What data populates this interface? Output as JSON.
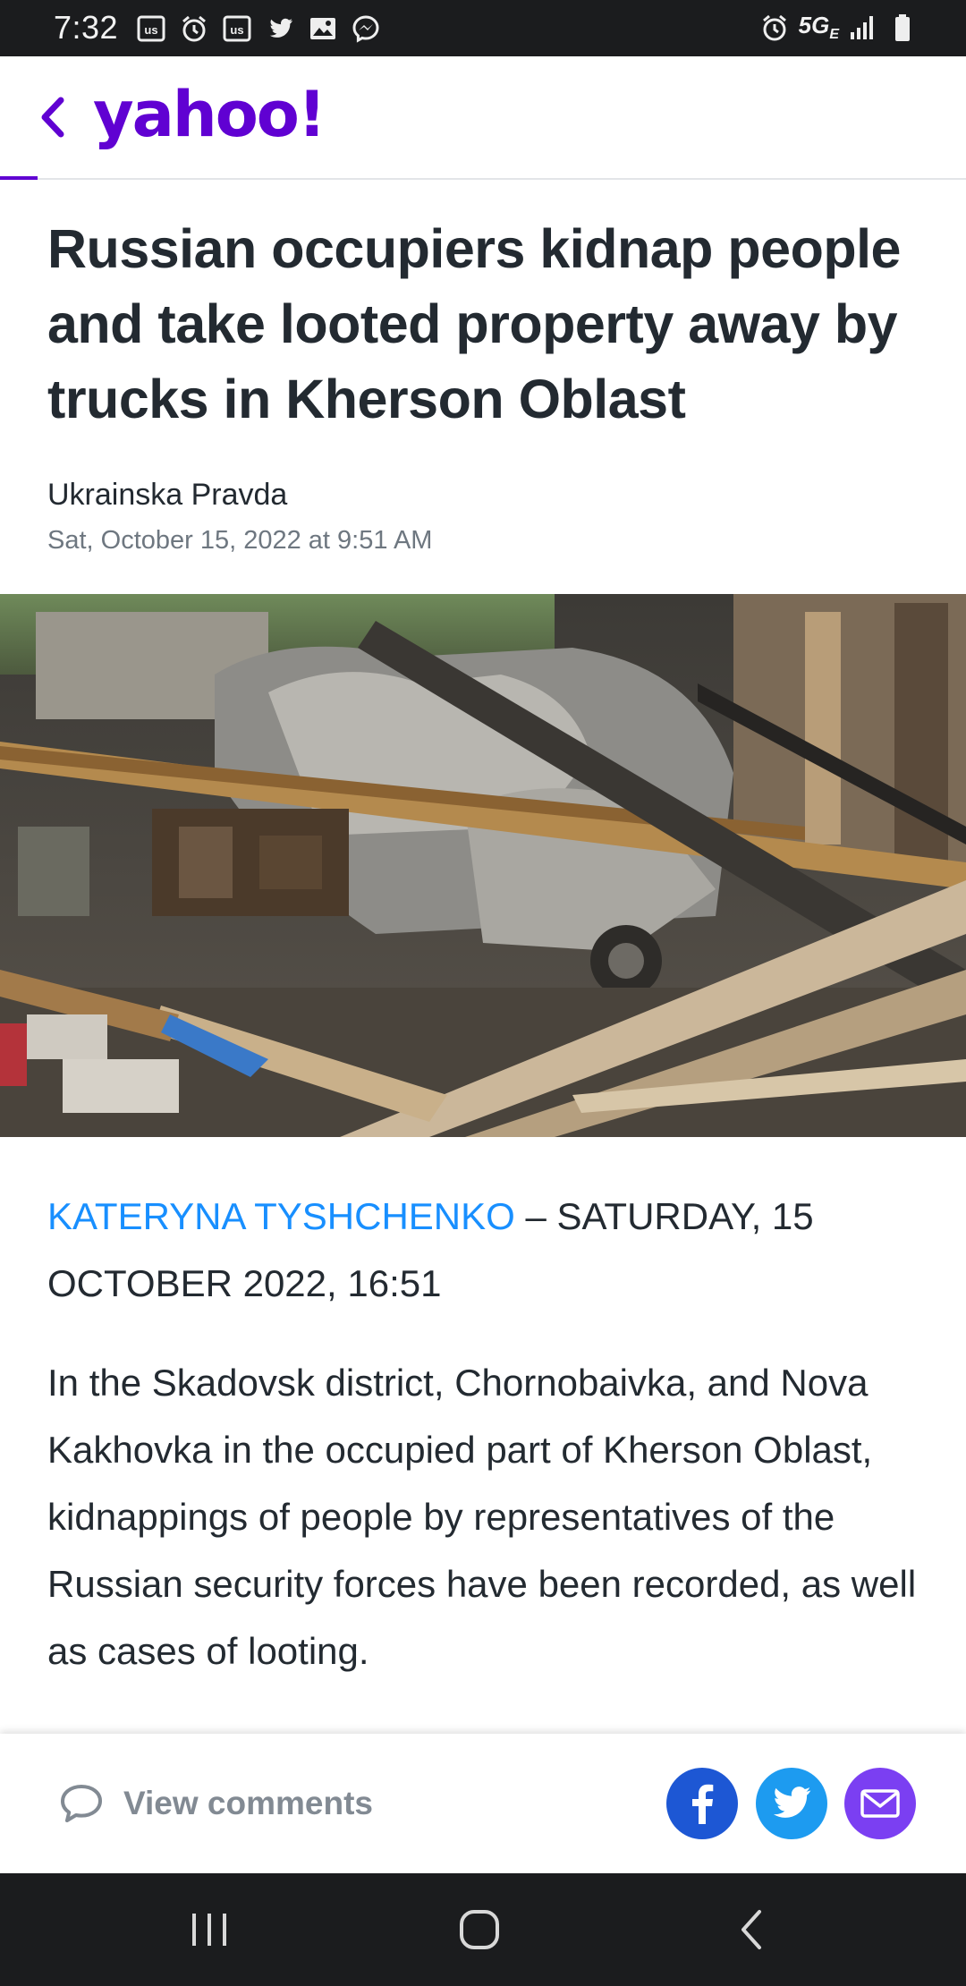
{
  "status_bar": {
    "time": "7:32",
    "network": "5G",
    "network_sub": "E",
    "icons_left": [
      "us-icon",
      "alarm-icon",
      "us-icon",
      "twitter-icon",
      "gallery-icon",
      "messenger-icon"
    ],
    "icons_right": [
      "alarm-icon",
      "signal-icon",
      "battery-icon"
    ]
  },
  "header": {
    "logo_text": "yahoo!",
    "brand_color": "#6001d2",
    "hidden_crumb": "Yahoo"
  },
  "article": {
    "headline": "Russian occupiers kidnap people and take looted property away by trucks in Kherson Oblast",
    "source": "Ukrainska Pravda",
    "published": "Sat, October 15, 2022 at 9:51 AM",
    "image_alt": "Burned-out car among collapsed wooden beams and rubble",
    "author": "KATERYNA TYSHCHENKO",
    "byline_rest": " – SATURDAY, 15 OCTOBER 2022, 16:51",
    "paragraph": "In the Skadovsk district, Chornobaivka, and Nova Kakhovka in the occupied part of Kherson Oblast, kidnappings of people by representatives of the Russian security forces have been recorded, as well as cases of looting."
  },
  "actions": {
    "comments_label": "View comments",
    "share_buttons": [
      {
        "name": "facebook",
        "color": "#1d57d4"
      },
      {
        "name": "twitter",
        "color": "#1d9bf0"
      },
      {
        "name": "email",
        "color": "#7b3ff2"
      }
    ]
  },
  "nav": {
    "buttons": [
      "recents",
      "home",
      "back"
    ]
  }
}
